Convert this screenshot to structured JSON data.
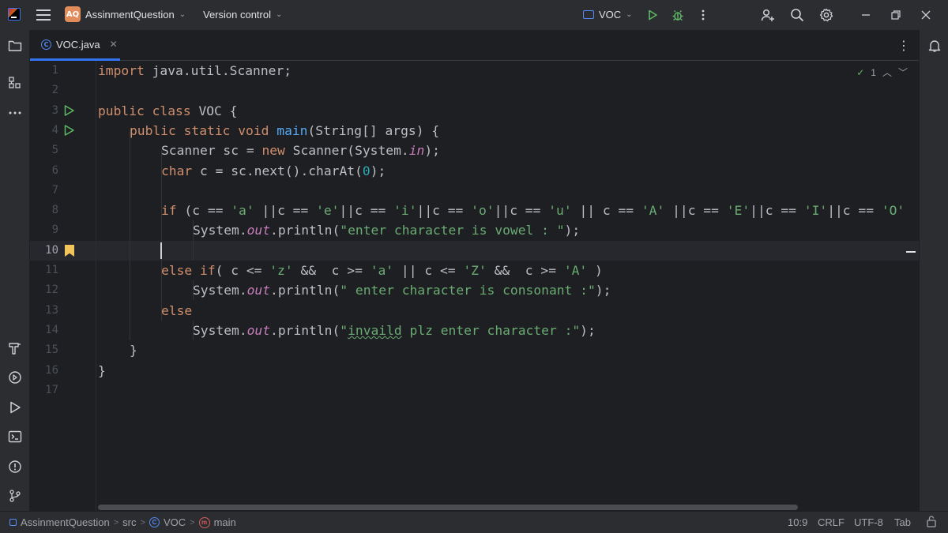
{
  "titlebar": {
    "project_initials": "AQ",
    "project_name": "AssinmentQuestion",
    "vcs_label": "Version control",
    "run_config": "VOC",
    "icons": [
      "app-logo-icon",
      "main-menu-icon",
      "run-icon",
      "debug-icon",
      "more-vertical-icon",
      "add-user-icon",
      "search-icon",
      "settings-icon",
      "minimize-icon",
      "restore-icon",
      "close-icon"
    ]
  },
  "left_toolbar": [
    "project-icon",
    "structure-icon",
    "more-tools-icon",
    "build-icon",
    "services-icon",
    "run-tool-icon",
    "terminal-icon",
    "problems-icon",
    "git-icon"
  ],
  "right_toolbar": [
    "notifications-icon"
  ],
  "tabs": [
    {
      "label": "VOC.java",
      "active": true
    }
  ],
  "editor": {
    "inspection_count": "1",
    "current_line": 10,
    "line_numbers": [
      "1",
      "2",
      "3",
      "4",
      "5",
      "6",
      "7",
      "8",
      "9",
      "10",
      "11",
      "12",
      "13",
      "14",
      "15",
      "16",
      "17"
    ],
    "code": {
      "l1_kw": "import",
      "l1_rest": " java.util.Scanner;",
      "l3_kw": "public class",
      "l3_rest": " VOC {",
      "l4_kw": "public static void",
      "l4_fn": "main",
      "l4_rest": "(String[] args) {",
      "l5_a": "Scanner sc = ",
      "l5_kw": "new",
      "l5_b": " Scanner(System.",
      "l5_static": "in",
      "l5_c": ");",
      "l6_kw": "char",
      "l6_a": " c = sc.next().charAt(",
      "l6_num": "0",
      "l6_b": ");",
      "l8_kw": "if",
      "l8_a": " (c == ",
      "l8_s1": "'a'",
      "l8_b": " ||c == ",
      "l8_s2": "'e'",
      "l8_c": "||c == ",
      "l8_s3": "'i'",
      "l8_d": "||c == ",
      "l8_s4": "'o'",
      "l8_e": "||c == ",
      "l8_s5": "'u'",
      "l8_f": " || c == ",
      "l8_s6": "'A'",
      "l8_g": " ||c == ",
      "l8_s7": "'E'",
      "l8_h": "||c == ",
      "l8_s8": "'I'",
      "l8_i": "||c == ",
      "l8_s9": "'O'",
      "l9_a": "System.",
      "l9_static": "out",
      "l9_b": ".println(",
      "l9_str": "\"enter character is vowel : \"",
      "l9_c": ");",
      "l11_kw1": "else if",
      "l11_a": "( c <= ",
      "l11_s1": "'z'",
      "l11_b": " &&  c >= ",
      "l11_s2": "'a'",
      "l11_c": " || c <= ",
      "l11_s3": "'Z'",
      "l11_d": " &&  c >= ",
      "l11_s4": "'A'",
      "l11_e": " )",
      "l12_a": "System.",
      "l12_static": "out",
      "l12_b": ".println(",
      "l12_str": "\" enter character is consonant :\"",
      "l12_c": ");",
      "l13_kw": "else",
      "l14_a": "System.",
      "l14_static": "out",
      "l14_b": ".println(",
      "l14_str_q": "\"",
      "l14_str_typo": "invaild",
      "l14_str_rest": " plz enter character :\"",
      "l14_c": ");",
      "l15": "}",
      "l16": "}"
    }
  },
  "statusbar": {
    "breadcrumbs": [
      "AssinmentQuestion",
      "src",
      "VOC",
      "main"
    ],
    "cursor_position": "10:9",
    "line_separator": "CRLF",
    "encoding": "UTF-8",
    "indent": "Tab"
  },
  "colors": {
    "background": "#1e1f22",
    "panel": "#2b2d30",
    "keyword": "#cf8e6d",
    "string": "#6aab73",
    "function": "#56a8f5",
    "number": "#2aacb8",
    "static_field": "#c77dbb",
    "accent": "#3574f0"
  }
}
